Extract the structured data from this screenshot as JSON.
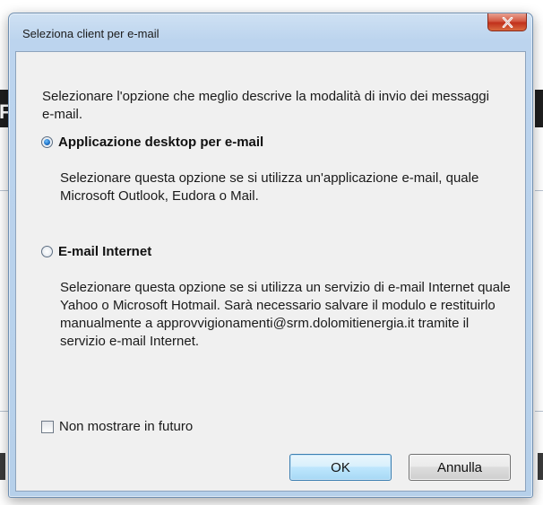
{
  "window": {
    "title": "Seleziona client per e-mail",
    "close_icon": "close-x-icon"
  },
  "intro_text": "Selezionare l'opzione che meglio descrive la modalità di invio dei messaggi e-mail.",
  "options": [
    {
      "label": "Applicazione desktop per e-mail",
      "selected": true,
      "description": "Selezionare questa opzione se si utilizza un'applicazione e-mail, quale Microsoft Outlook, Eudora o Mail."
    },
    {
      "label": "E-mail Internet",
      "selected": false,
      "description": "Selezionare questa opzione se si utilizza un servizio di e-mail Internet quale Yahoo o Microsoft Hotmail. Sarà necessario salvare il modulo e restituirlo manualmente a approvvigionamenti@srm.dolomitienergia.it tramite il servizio e-mail Internet."
    }
  ],
  "dont_show_label": "Non mostrare in futuro",
  "buttons": {
    "ok": "OK",
    "cancel": "Annulla"
  },
  "background": {
    "glyph": "F"
  }
}
